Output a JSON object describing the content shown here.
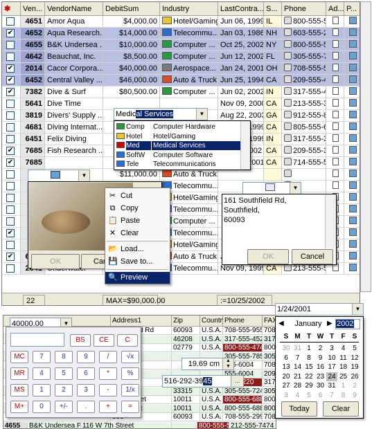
{
  "grid": {
    "headers": [
      "Ven...",
      "VendorName",
      "DebitSum",
      "Industry",
      "LastContra...",
      "S...",
      "Phone",
      "Ad...",
      "P..."
    ],
    "rows": [
      {
        "checked": false,
        "id": "4651",
        "name": "Amor Aqua",
        "debit": "$4,000.00",
        "industry": "Hotel/Gaming",
        "date": "Jun 06, 1999",
        "state": "IL",
        "phone": "800-555-5...",
        "hl": false
      },
      {
        "checked": true,
        "id": "4652",
        "name": "Aqua Research...",
        "debit": "$14,000.00",
        "industry": "Telecommu...",
        "date": "Jan 03, 1986",
        "state": "NH",
        "phone": "603-555-2...",
        "hl": true
      },
      {
        "checked": false,
        "id": "4655",
        "name": "B&K Undersea ...",
        "debit": "$10,000.00",
        "industry": "Computer ...",
        "date": "Oct 25, 2002",
        "state": "NY",
        "phone": "800-555-5...",
        "hl": true
      },
      {
        "checked": false,
        "id": "4642",
        "name": "Beauchat, Inc.",
        "debit": "$8,500.00",
        "industry": "Computer ...",
        "date": "Jun 12, 2002",
        "state": "FL",
        "phone": "305-555-7...",
        "hl": true
      },
      {
        "checked": true,
        "id": "2014",
        "name": "Cacor Corpora...",
        "debit": "$40,000.00",
        "industry": "Aerospace...",
        "date": "Jan 24, 2001",
        "state": "OH",
        "phone": "708-555-5...",
        "hl": true
      },
      {
        "checked": true,
        "id": "6452",
        "name": "Central Valley ...",
        "debit": "$46,000.00",
        "industry": "Auto & Truck",
        "date": "Jun 25, 1994",
        "state": "CA",
        "phone": "209-555-4...",
        "hl": true
      },
      {
        "checked": true,
        "id": "7382",
        "name": "Dive & Surf",
        "debit": "$80,500.00",
        "industry": "Computer ...",
        "date": "Jun 02, 2002",
        "state": "IN",
        "phone": "317-555-4...",
        "hl": false
      },
      {
        "checked": false,
        "id": "5641",
        "name": "Dive Time",
        "debit": "",
        "industry": "",
        "date": "Nov 09, 2000",
        "state": "CA",
        "phone": "213-555-3...",
        "hl": false
      },
      {
        "checked": false,
        "id": "3819",
        "name": "Divers'  Supply ...",
        "debit": "",
        "industry": "",
        "date": "Aug 22, 2003",
        "state": "GA",
        "phone": "912-555-8...",
        "hl": false
      },
      {
        "checked": false,
        "id": "4681",
        "name": "Diving Internat...",
        "debit": "",
        "industry": "",
        "date": "Feb 20, 1999",
        "state": "CA",
        "phone": "805-555-6...",
        "hl": false
      },
      {
        "checked": false,
        "id": "6451",
        "name": "Felix Diving",
        "debit": "",
        "industry": "",
        "date": "Sep 24, 1999",
        "state": "IN",
        "phone": "317-555-3...",
        "hl": false
      },
      {
        "checked": true,
        "id": "7685",
        "name": "Fish Research ...",
        "debit": "",
        "industry": "",
        "date": "Jul 21, 2002",
        "state": "CA",
        "phone": "209-555-3...",
        "hl": false
      },
      {
        "checked": true,
        "id": "7685",
        "name": "",
        "debit": "",
        "industry": "",
        "date": "Jan 06, 2001",
        "state": "CA",
        "phone": "714-555-5...",
        "hl": false
      },
      {
        "checked": false,
        "id": "",
        "name": "",
        "debit": "$11,000.00",
        "industry": "Auto & Truck",
        "date": "",
        "state": "",
        "phone": "",
        "hl": false
      },
      {
        "checked": false,
        "id": "",
        "name": "",
        "debit": "",
        "industry": "Telecommu...",
        "date": "",
        "state": "",
        "phone": "",
        "hl": false
      },
      {
        "checked": false,
        "id": "",
        "name": "",
        "debit": "",
        "industry": "Hotel/Gaming",
        "date": "",
        "state": "",
        "phone": "",
        "hl": false
      },
      {
        "checked": false,
        "id": "",
        "name": "",
        "debit": "",
        "industry": "Telecommu...",
        "date": "",
        "state": "",
        "phone": "",
        "hl": false
      },
      {
        "checked": false,
        "id": "",
        "name": "",
        "debit": "",
        "industry": "Computer ...",
        "date": "",
        "state": "",
        "phone": "",
        "hl": false
      },
      {
        "checked": true,
        "id": "",
        "name": "",
        "debit": "",
        "industry": "Telecommu...",
        "date": "",
        "state": "",
        "phone": "",
        "hl": false
      },
      {
        "checked": false,
        "id": "",
        "name": "",
        "debit": "",
        "industry": "Hotel/Gaming",
        "date": "",
        "state": "",
        "phone": "",
        "hl": false
      },
      {
        "checked": true,
        "id": "6415",
        "name": "Undersea Syst...",
        "debit": "",
        "industry": "Auto & Truck",
        "date": "Jun 17, 2002",
        "state": "CA",
        "phone": "209-555-7...",
        "hl": false
      },
      {
        "checked": false,
        "id": "2641",
        "name": "Underwater",
        "debit": "",
        "industry": "Telecommu...",
        "date": "Nov 09, 1999",
        "state": "CA",
        "phone": "213-555-5...",
        "hl": false
      }
    ],
    "footer": {
      "count": "22",
      "max": "MAX=$90,000.00",
      "date": ":=10/25/2002"
    }
  },
  "industry_combo": {
    "value": "Medical Services",
    "typed": "Medic",
    "items": [
      {
        "code": "Comp",
        "label": "Computer Hardware"
      },
      {
        "code": "Hotel",
        "label": "Hotel/Gaming"
      },
      {
        "code": "Med",
        "label": "Medical Services"
      },
      {
        "code": "SoftW",
        "label": "Computer Software"
      },
      {
        "code": "Tele",
        "label": "Telecommunications"
      }
    ]
  },
  "image_popup": {
    "ok": "OK",
    "cancel": "Cancel"
  },
  "context_menu": {
    "items": [
      "Cut",
      "Copy",
      "Paste",
      "Clear",
      "Load...",
      "Save to...",
      "Preview"
    ]
  },
  "address_popup": {
    "text": "161 Southfield Rd,\nSouthfield,\n60093",
    "ok": "OK",
    "cancel": "Cancel"
  },
  "grid2": {
    "headers": [
      "",
      "Address1",
      "Zip",
      "Country",
      "Phone",
      "FAX"
    ],
    "rows": [
      [
        "",
        "Southfield Rd",
        "60093",
        "U.S.A.",
        "708-555-9555",
        "708"
      ],
      [
        "",
        "Street",
        "46208",
        "U.S.A.",
        "317-555-4523",
        "317"
      ],
      [
        "",
        "Street",
        "02779",
        "U.S.A.",
        "800-555-4744",
        "800"
      ],
      [
        "",
        "Brace",
        "",
        "",
        "305-555-7850",
        "305"
      ],
      [
        "",
        "ersity Dr",
        "",
        "",
        "555-6004",
        "708"
      ],
      [
        "",
        "Ave",
        "",
        "",
        "555-6004",
        "209"
      ],
      [
        "",
        "ves Ave",
        "",
        "",
        "555-6220",
        "317"
      ],
      [
        "",
        "2nd Ave",
        "33315",
        "U.S.A.",
        "305-555-7242",
        "305"
      ],
      [
        "",
        "29th Street",
        "10011",
        "U.S.A.",
        "800-555-6880",
        "800"
      ],
      [
        "",
        "9th Street",
        "10011",
        "U.S.A.",
        "800-555-6880",
        "800"
      ],
      [
        "",
        "998",
        "60093",
        "U.S.A.",
        "708-555-2995",
        "708"
      ],
      [
        "4655",
        "B&K Undersea Photo",
        "116 W 7th Street",
        "",
        "800-555-5662",
        "212-555-7474"
      ]
    ],
    "amount_input": "40000.00",
    "size_value": "19.69 cm",
    "phone_value": "516-292-3945",
    "phone_typed": "516-292-39",
    "phone_sel": "45"
  },
  "calculator": {
    "display": "",
    "keys": [
      [
        "BS",
        "CE",
        "C"
      ],
      [
        "MC",
        "7",
        "8",
        "9",
        "/",
        "√x"
      ],
      [
        "MR",
        "4",
        "5",
        "6",
        "*",
        "%"
      ],
      [
        "MS",
        "1",
        "2",
        "3",
        "-",
        "1/x"
      ],
      [
        "M+",
        "0",
        "+/-",
        ".",
        "+",
        "="
      ]
    ]
  },
  "calendar": {
    "input": "1/24/2001",
    "month": "January",
    "year": "2002",
    "dow": [
      "S",
      "M",
      "T",
      "W",
      "T",
      "F",
      "S"
    ],
    "weeks": [
      [
        "30",
        "31",
        "1",
        "2",
        "3",
        "4",
        "5"
      ],
      [
        "6",
        "7",
        "8",
        "9",
        "10",
        "11",
        "12"
      ],
      [
        "13",
        "14",
        "15",
        "16",
        "17",
        "18",
        "19"
      ],
      [
        "20",
        "21",
        "22",
        "23",
        "24",
        "25",
        "26"
      ],
      [
        "27",
        "28",
        "29",
        "30",
        "31",
        "1",
        "2"
      ],
      [
        "3",
        "4",
        "5",
        "6",
        "7",
        "8",
        "9"
      ]
    ],
    "selected": "24",
    "today_label": "Today",
    "clear_label": "Clear"
  },
  "colors": {
    "highlight": "#b9bfe0",
    "selection_blue": "#0a246a",
    "phone_red": "#8b1c1c",
    "header": "#ece9d8"
  }
}
